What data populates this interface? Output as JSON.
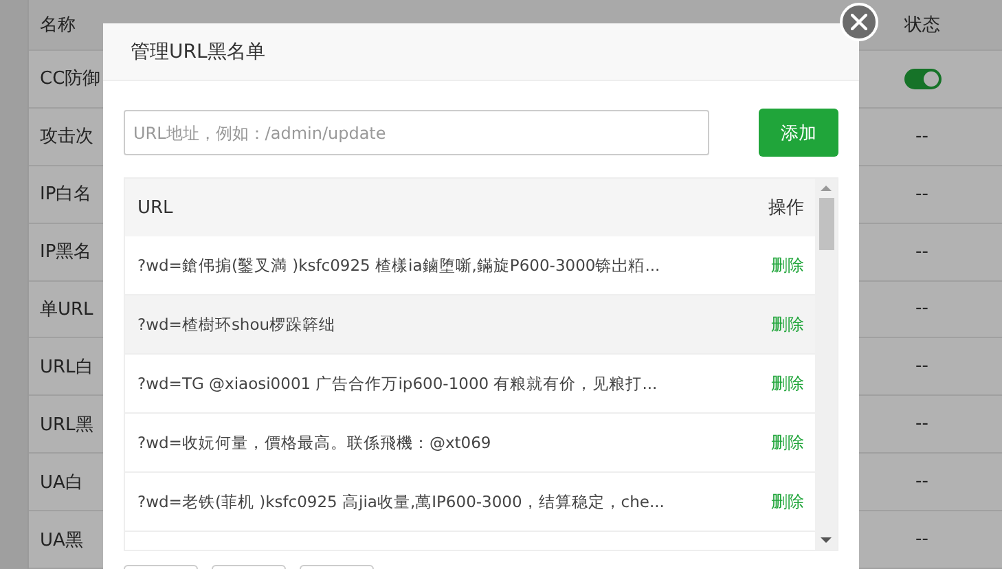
{
  "background_table": {
    "columns": [
      {
        "label": "名称"
      },
      {
        "label": "状态"
      }
    ],
    "rows": [
      {
        "name": "CC防御",
        "kind": "toggle",
        "on": true
      },
      {
        "name": "攻击次",
        "kind": "text",
        "status": "--"
      },
      {
        "name": "IP白名",
        "kind": "text",
        "status": "--"
      },
      {
        "name": "IP黑名",
        "kind": "text",
        "status": "--"
      },
      {
        "name": "单URL",
        "kind": "text",
        "status": "--"
      },
      {
        "name": "URL白",
        "kind": "text",
        "status": "--"
      },
      {
        "name": "URL黑",
        "kind": "text",
        "status": "--"
      },
      {
        "name": "UA白",
        "kind": "text",
        "status": "--"
      },
      {
        "name": "UA黑",
        "kind": "text",
        "status": "--"
      }
    ]
  },
  "dialog": {
    "title": "管理URL黑名单",
    "url_field": {
      "placeholder": "URL地址，例如：/admin/update"
    },
    "add_button": "添加",
    "table": {
      "columns": [
        "URL",
        "操作"
      ],
      "rows": [
        {
          "url": "?wd=鎗伄掮(鑿叉満 )ksfc0925 楂樣ia鏀堕噺,鏋旋P600-3000锛岀粨...",
          "action": "删除",
          "selected": false
        },
        {
          "url": "?wd=楂樹环shou椤跺簳绌",
          "action": "删除",
          "selected": true
        },
        {
          "url": "?wd=TG @xiaosi0001 广告合作万ip600-1000 有粮就有价，见粮打...",
          "action": "删除",
          "selected": false
        },
        {
          "url": "?wd=收妧何量，價格最高。联係飛機：@xt069",
          "action": "删除",
          "selected": false
        },
        {
          "url": "?wd=老铁(菲机 )ksfc0925 高jia收量,萬IP600-3000，结算稳定，che...",
          "action": "删除",
          "selected": false
        }
      ]
    }
  }
}
